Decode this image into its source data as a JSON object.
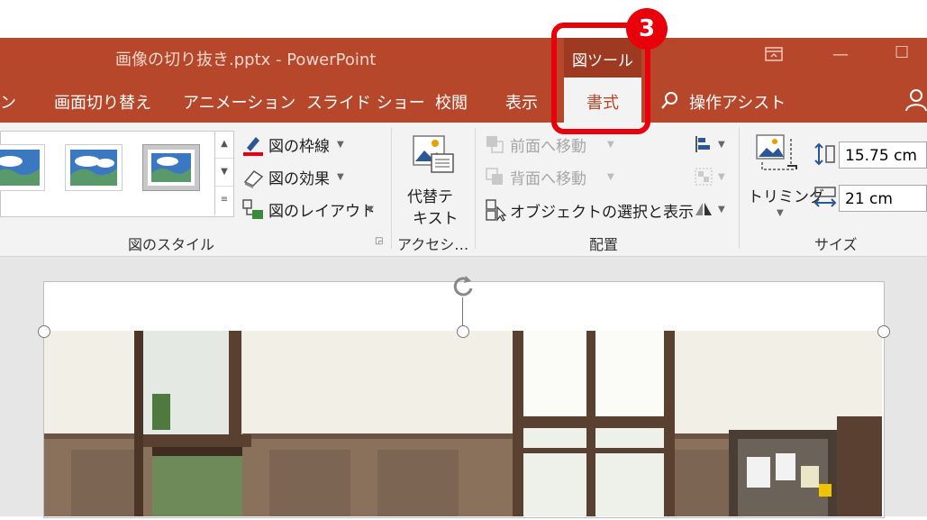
{
  "window": {
    "title": "画像の切り抜き.pptx  -  PowerPoint",
    "controls": {
      "restore_icon": "ribbon-display-icon",
      "minimize": "—",
      "maximize": "☐"
    }
  },
  "context_group": {
    "label": "図ツール"
  },
  "tabs": [
    {
      "label": "ン",
      "active": false
    },
    {
      "label": "画面切り替え",
      "active": false
    },
    {
      "label": "アニメーション",
      "active": false
    },
    {
      "label": "スライド ショー",
      "active": false
    },
    {
      "label": "校閲",
      "active": false
    },
    {
      "label": "表示",
      "active": false
    },
    {
      "label": "書式",
      "active": true
    }
  ],
  "tell_me": {
    "label": "操作アシスト",
    "icon": "search-icon"
  },
  "ribbon": {
    "picture_styles": {
      "label": "図のスタイル",
      "border": "図の枠線",
      "effects": "図の効果",
      "layout": "図のレイアウト"
    },
    "accessibility": {
      "label": "アクセシ…",
      "alt_text_line1": "代替テ",
      "alt_text_line2": "キスト"
    },
    "arrange": {
      "label": "配置",
      "bring_forward": "前面へ移動",
      "send_backward": "背面へ移動",
      "selection_pane": "オブジェクトの選択と表示"
    },
    "size": {
      "label": "サイズ",
      "crop": "トリミング",
      "height": "15.75 cm",
      "width": "21 cm"
    }
  },
  "callout": {
    "number": "3"
  },
  "colors": {
    "accent": "#b7472a",
    "callout": "#e8000a"
  }
}
